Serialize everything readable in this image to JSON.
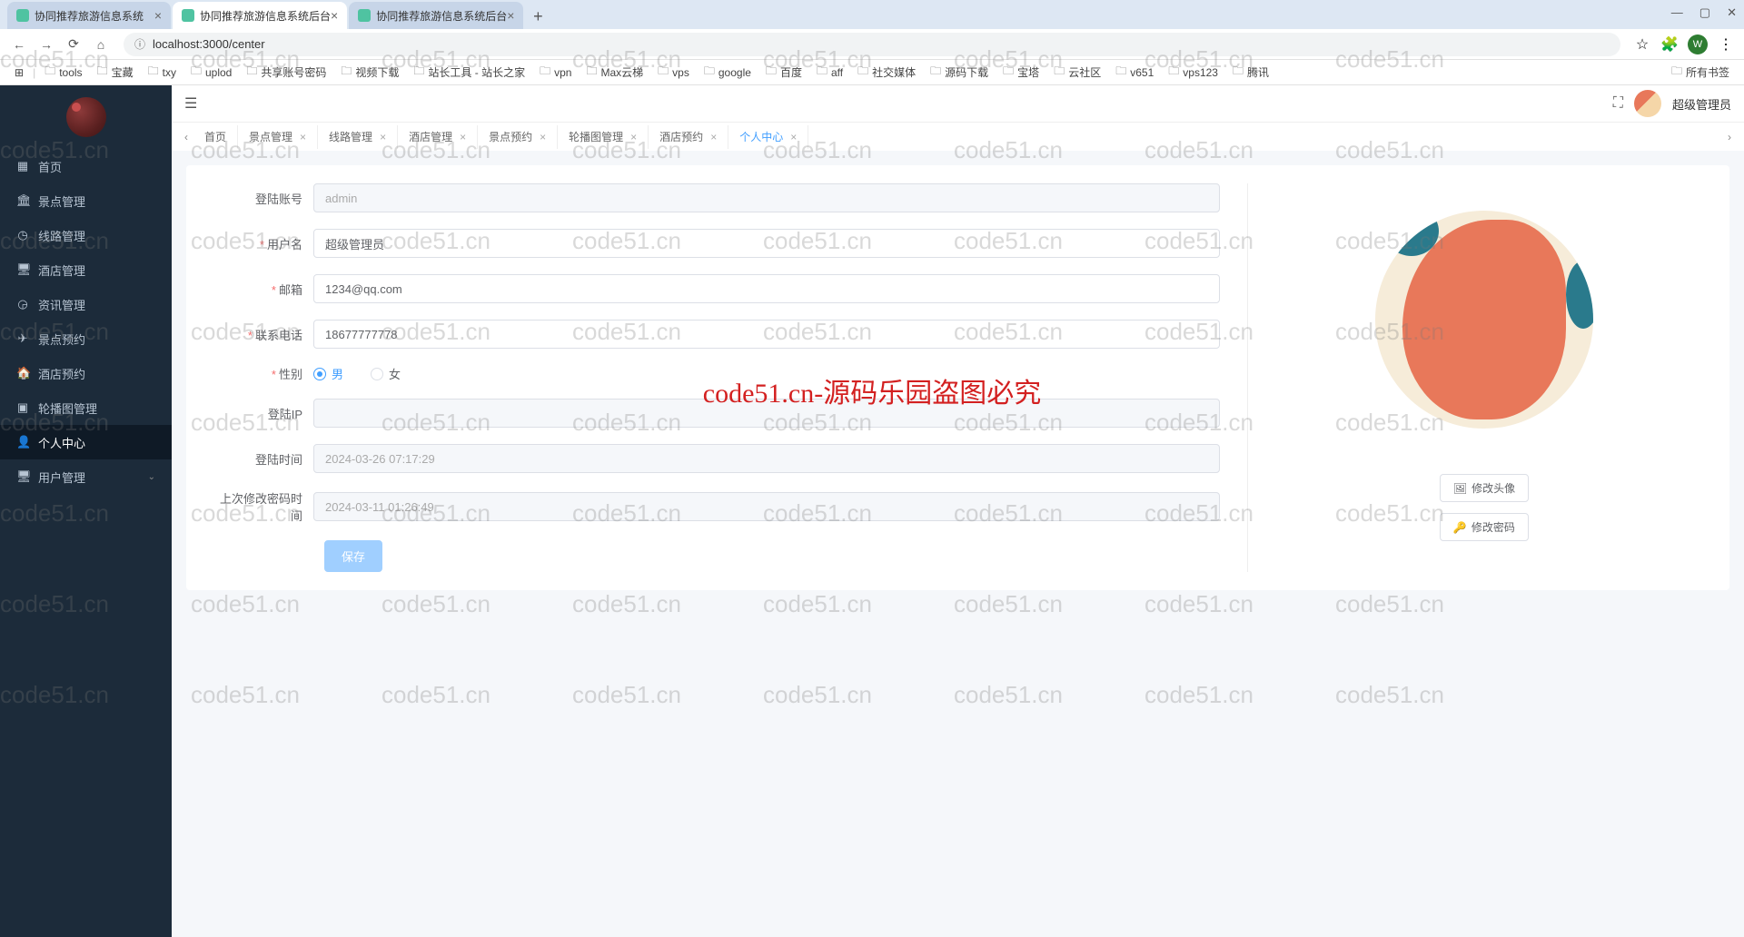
{
  "browser": {
    "tabs": [
      {
        "title": "协同推荐旅游信息系统",
        "active": false
      },
      {
        "title": "协同推荐旅游信息系统后台",
        "active": true
      },
      {
        "title": "协同推荐旅游信息系统后台",
        "active": false
      }
    ],
    "url": "localhost:3000/center",
    "profile_letter": "W",
    "bookmarks": [
      "tools",
      "宝藏",
      "txy",
      "uplod",
      "共享账号密码",
      "视频下载",
      "站长工具 - 站长之家",
      "vpn",
      "Max云梯",
      "vps",
      "google",
      "百度",
      "aff",
      "社交媒体",
      "源码下载",
      "宝塔",
      "云社区",
      "v651",
      "vps123",
      "腾讯"
    ],
    "all_bookmarks": "所有书签"
  },
  "sidebar": {
    "items": [
      {
        "icon": "▦",
        "label": "首页"
      },
      {
        "icon": "🏛",
        "label": "景点管理"
      },
      {
        "icon": "◷",
        "label": "线路管理"
      },
      {
        "icon": "🖥",
        "label": "酒店管理"
      },
      {
        "icon": "◶",
        "label": "资讯管理"
      },
      {
        "icon": "✈",
        "label": "景点预约"
      },
      {
        "icon": "🏠",
        "label": "酒店预约"
      },
      {
        "icon": "▣",
        "label": "轮播图管理"
      },
      {
        "icon": "👤",
        "label": "个人中心"
      },
      {
        "icon": "🖥",
        "label": "用户管理",
        "expandable": true
      }
    ],
    "active_index": 8
  },
  "header": {
    "user_name": "超级管理员"
  },
  "page_tabs": {
    "items": [
      "首页",
      "景点管理",
      "线路管理",
      "酒店管理",
      "景点预约",
      "轮播图管理",
      "酒店预约",
      "个人中心"
    ],
    "active_index": 7
  },
  "form": {
    "account": {
      "label": "登陆账号",
      "value": "admin",
      "disabled": true
    },
    "username": {
      "label": "用户名",
      "value": "超级管理员",
      "required": true
    },
    "email": {
      "label": "邮箱",
      "value": "1234@qq.com",
      "required": true
    },
    "phone": {
      "label": "联系电话",
      "value": "18677777778",
      "required": true
    },
    "gender": {
      "label": "性别",
      "required": true,
      "options": [
        "男",
        "女"
      ],
      "selected": "男"
    },
    "login_ip": {
      "label": "登陆IP",
      "value": "",
      "disabled": true
    },
    "login_time": {
      "label": "登陆时间",
      "value": "2024-03-26 07:17:29",
      "disabled": true
    },
    "pwd_time": {
      "label": "上次修改密码时间",
      "value": "2024-03-11 01:26:49",
      "disabled": true
    },
    "save_btn": "保存"
  },
  "avatar_panel": {
    "change_avatar": "修改头像",
    "change_password": "修改密码"
  },
  "watermark": {
    "text": "code51.cn",
    "center": "code51.cn-源码乐园盗图必究"
  }
}
